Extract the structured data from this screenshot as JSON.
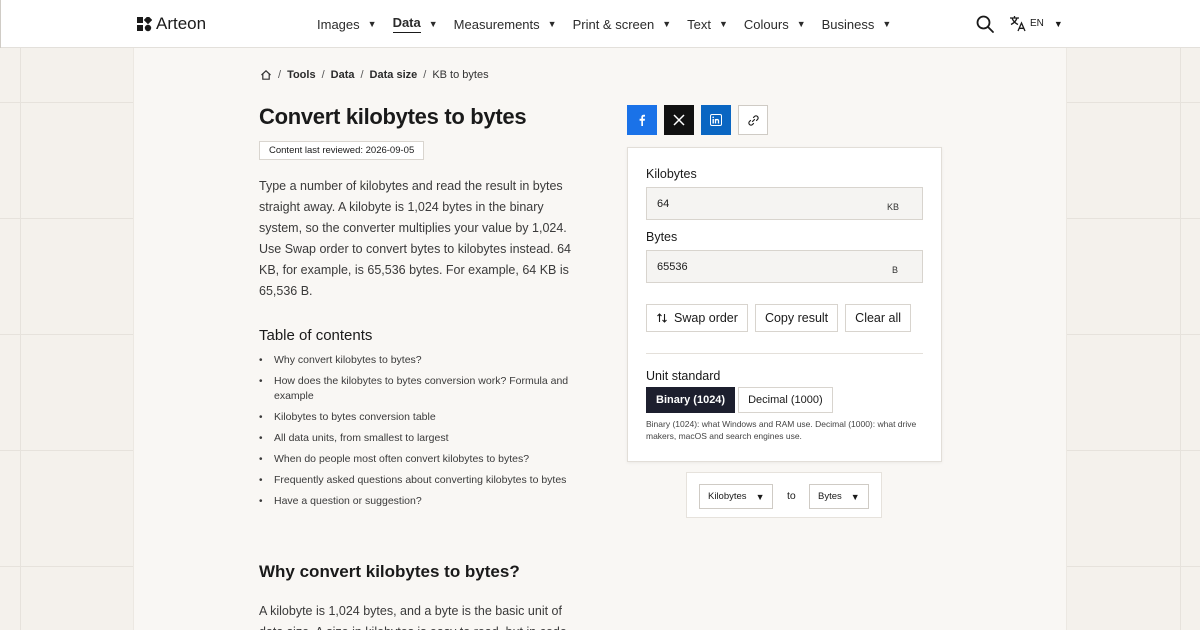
{
  "brand": {
    "name": "Arteon"
  },
  "nav": [
    {
      "label": "Images",
      "active": false
    },
    {
      "label": "Data",
      "active": true
    },
    {
      "label": "Measurements",
      "active": false
    },
    {
      "label": "Print & screen",
      "active": false
    },
    {
      "label": "Text",
      "active": false
    },
    {
      "label": "Colours",
      "active": false
    },
    {
      "label": "Business",
      "active": false
    }
  ],
  "header": {
    "lang": "EN"
  },
  "breadcrumb": {
    "items": [
      "Tools",
      "Data",
      "Data size"
    ],
    "current": "KB to bytes"
  },
  "page": {
    "title": "Convert kilobytes to bytes",
    "reviewed": "Content last reviewed: 2026-09-05",
    "intro": "Type a number of kilobytes and read the result in bytes straight away. A kilobyte is 1,024 bytes in the binary system, so the converter multiplies your value by 1,024. Use Swap order to convert bytes to kilobytes instead. 64 KB, for example, is 65,536 bytes. For example, 64 KB is 65,536 B.",
    "toc_title": "Table of contents",
    "toc": [
      "Why convert kilobytes to bytes?",
      "How does the kilobytes to bytes conversion work? Formula and example",
      "Kilobytes to bytes conversion table",
      "All data units, from smallest to largest",
      "When do people most often convert kilobytes to bytes?",
      "Frequently asked questions about converting kilobytes to bytes",
      "Have a question or suggestion?"
    ],
    "why_title": "Why convert kilobytes to bytes?",
    "why_text": "A kilobyte is 1,024 bytes, and a byte is the basic unit of data size. A size in kilobytes is easy to read, but in code"
  },
  "converter": {
    "from_label": "Kilobytes",
    "from_value": "64",
    "from_unit": "KB",
    "to_label": "Bytes",
    "to_value": "65536",
    "to_unit": "B",
    "swap_label": "Swap order",
    "copy_label": "Copy result",
    "clear_label": "Clear all",
    "unit_standard_label": "Unit standard",
    "options": [
      "Binary (1024)",
      "Decimal (1000)"
    ],
    "selected_option": "Binary (1024)",
    "note": "Binary (1024): what Windows and RAM use. Decimal (1000): what drive makers, macOS and search engines use."
  },
  "unit_pair": {
    "from": "Kilobytes",
    "to_word": "to",
    "to": "Bytes"
  }
}
